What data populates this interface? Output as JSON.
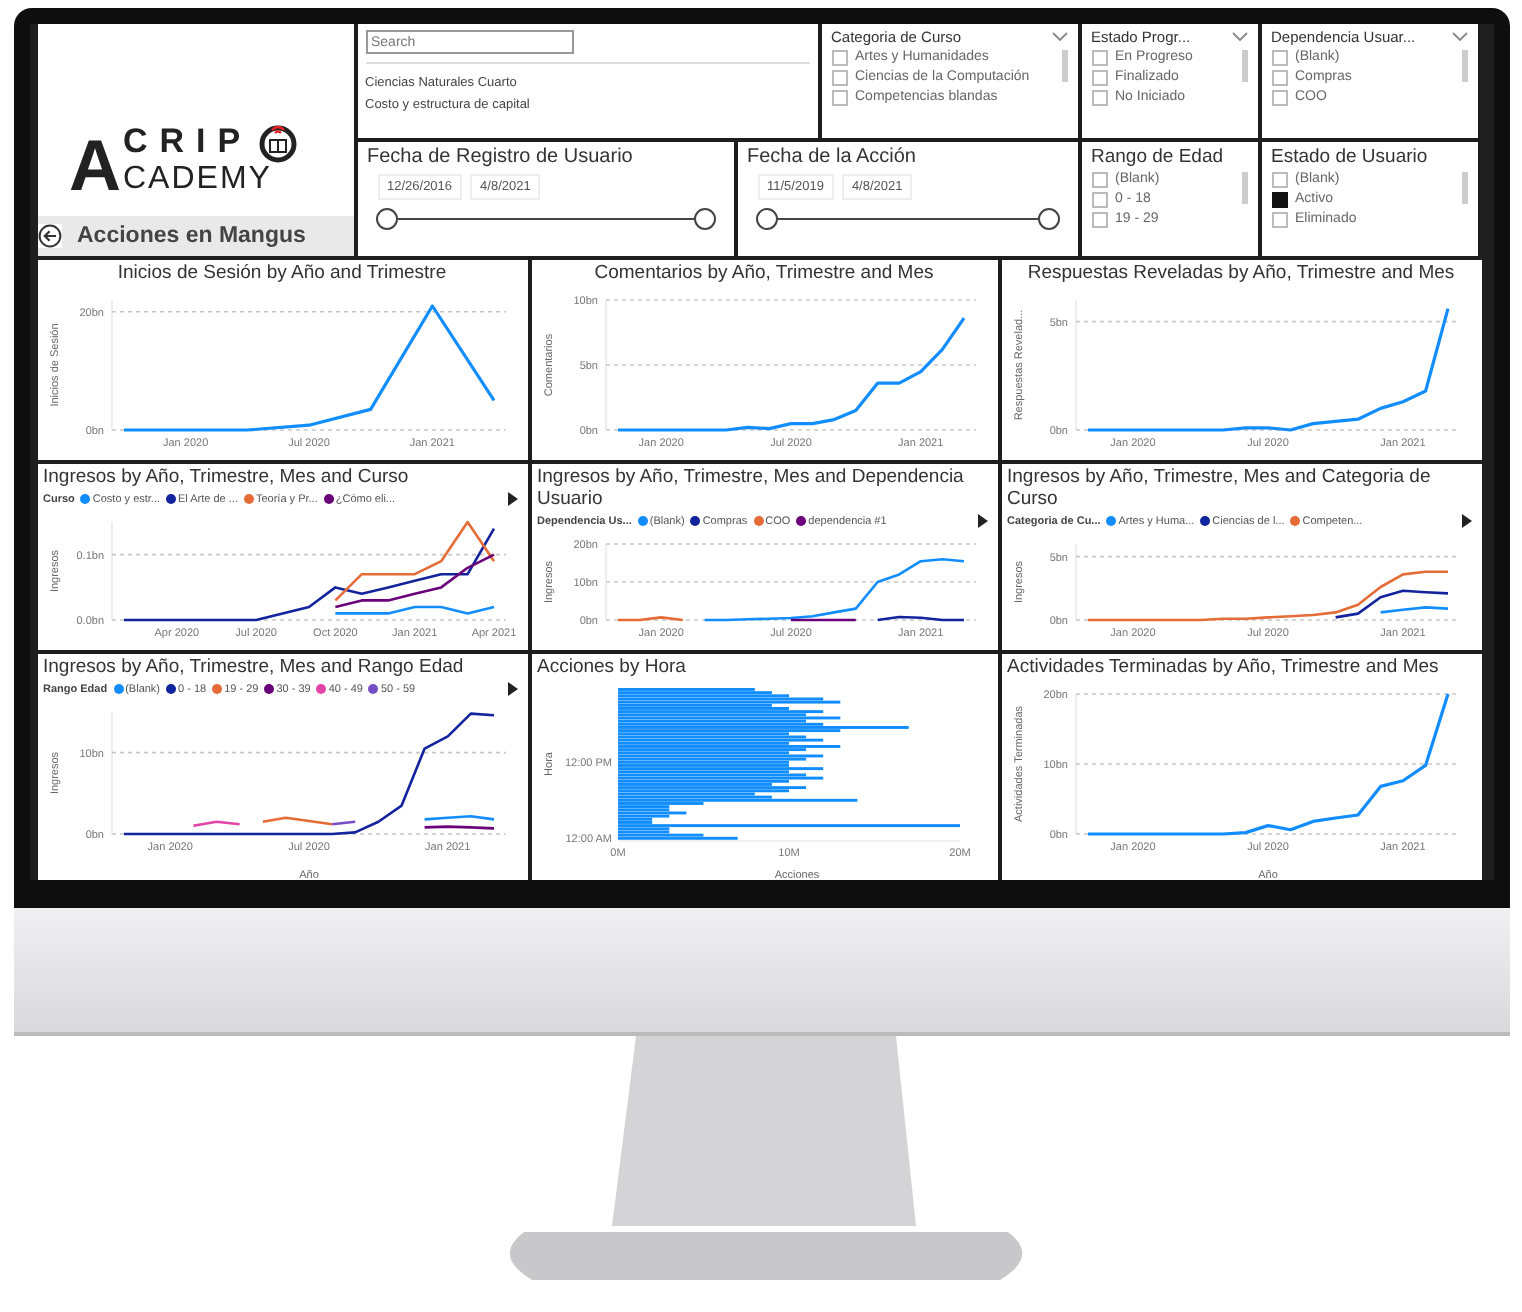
{
  "header": {
    "logo": {
      "letter": "A",
      "top": "CRIP",
      "bottom": "CADEMY"
    },
    "page_title": "Acciones en Mangus"
  },
  "slicers": [
    {
      "kind": "search-list",
      "placeholder": "Search",
      "items": [
        "Ciencias Naturales Cuarto",
        "Costo y estructura de capital"
      ]
    },
    {
      "kind": "checklist",
      "title": "Categoria de Curso",
      "dropdown": true,
      "items": [
        {
          "label": "Artes y Humanidades",
          "checked": false
        },
        {
          "label": "Ciencias de la Computación",
          "checked": false
        },
        {
          "label": "Competencias blandas",
          "checked": false
        }
      ]
    },
    {
      "kind": "checklist",
      "title": "Estado Progr...",
      "dropdown": true,
      "items": [
        {
          "label": "En Progreso",
          "checked": false
        },
        {
          "label": "Finalizado",
          "checked": false
        },
        {
          "label": "No Iniciado",
          "checked": false
        }
      ]
    },
    {
      "kind": "checklist",
      "title": "Dependencia Usuar...",
      "dropdown": true,
      "items": [
        {
          "label": "(Blank)",
          "checked": false
        },
        {
          "label": "Compras",
          "checked": false
        },
        {
          "label": "COO",
          "checked": false
        }
      ]
    },
    {
      "kind": "date-range",
      "title": "Fecha de Registro de Usuario",
      "start": "12/26/2016",
      "end": "4/8/2021"
    },
    {
      "kind": "date-range",
      "title": "Fecha de la Acción",
      "start": "11/5/2019",
      "end": "4/8/2021"
    },
    {
      "kind": "checklist",
      "title": "Rango de Edad",
      "dropdown": false,
      "items": [
        {
          "label": "(Blank)",
          "checked": false
        },
        {
          "label": "0 - 18",
          "checked": false
        },
        {
          "label": "19 - 29",
          "checked": false
        }
      ]
    },
    {
      "kind": "checklist",
      "title": "Estado de Usuario",
      "dropdown": false,
      "items": [
        {
          "label": "(Blank)",
          "checked": false
        },
        {
          "label": "Activo",
          "checked": true
        },
        {
          "label": "Eliminado",
          "checked": false
        }
      ]
    }
  ],
  "visuals": [
    {
      "chart_data": {
        "type": "line",
        "title": "Inicios de Sesión by Año and Trimestre",
        "ylabel": "Inicios de Sesión",
        "grid": true,
        "categories": [
          null,
          "Jan 2020",
          null,
          "Jul 2020",
          null,
          "Jan 2021",
          null
        ],
        "ylim": [
          0,
          22
        ],
        "yticks": [
          {
            "value": 0,
            "label": "0bn"
          },
          {
            "value": 20,
            "label": "20bn"
          }
        ],
        "series": [
          {
            "color": "#118dff",
            "values": [
              0,
              0,
              0,
              0.8,
              3.5,
              21,
              5
            ]
          }
        ]
      }
    },
    {
      "chart_data": {
        "type": "line",
        "title": "Comentarios by Año, Trimestre and Mes",
        "ylabel": "Comentarios",
        "grid": true,
        "categories": [
          null,
          null,
          "Jan 2020",
          null,
          null,
          null,
          null,
          null,
          "Jul 2020",
          null,
          null,
          null,
          null,
          null,
          "Jan 2021",
          null,
          null
        ],
        "ylim": [
          0,
          10
        ],
        "yticks": [
          {
            "value": 0,
            "label": "0bn"
          },
          {
            "value": 5,
            "label": "5bn"
          },
          {
            "value": 10,
            "label": "10bn"
          }
        ],
        "series": [
          {
            "color": "#118dff",
            "values": [
              0,
              0,
              0,
              0,
              0,
              0,
              0.2,
              0.1,
              0.5,
              0.5,
              0.8,
              1.5,
              3.6,
              3.6,
              4.5,
              6.2,
              8.6
            ]
          }
        ]
      }
    },
    {
      "chart_data": {
        "type": "line",
        "title": "Respuestas Reveladas by Año, Trimestre and Mes",
        "ylabel": "Respuestas Revelad...",
        "grid": true,
        "categories": [
          null,
          null,
          "Jan 2020",
          null,
          null,
          null,
          null,
          null,
          "Jul 2020",
          null,
          null,
          null,
          null,
          null,
          "Jan 2021",
          null,
          null
        ],
        "ylim": [
          0,
          6
        ],
        "yticks": [
          {
            "value": 0,
            "label": "0bn"
          },
          {
            "value": 5,
            "label": "5bn"
          }
        ],
        "series": [
          {
            "color": "#118dff",
            "values": [
              0,
              0,
              0,
              0,
              0,
              0,
              0,
              0.1,
              0.1,
              0,
              0.3,
              0.4,
              0.5,
              1,
              1.3,
              1.8,
              5.6
            ]
          }
        ]
      }
    },
    {
      "chart_data": {
        "type": "line",
        "title": "Ingresos by Año, Trimestre, Mes and Curso",
        "ylabel": "Ingresos",
        "grid": true,
        "legend_title": "Curso",
        "categories": [
          null,
          null,
          "Apr 2020",
          null,
          null,
          "Jul 2020",
          null,
          null,
          "Oct 2020",
          null,
          null,
          "Jan 2021",
          null,
          null,
          "Apr 2021"
        ],
        "ylim": [
          0,
          0.15
        ],
        "yticks": [
          {
            "value": 0,
            "label": "0.0bn"
          },
          {
            "value": 0.1,
            "label": "0.1bn"
          }
        ],
        "series": [
          {
            "name": "Costo y estr...",
            "color": "#118dff",
            "values": [
              null,
              null,
              null,
              null,
              null,
              null,
              null,
              null,
              0.01,
              0.01,
              0.01,
              0.02,
              0.02,
              0.01,
              0.02
            ]
          },
          {
            "name": "El Arte de ...",
            "color": "#12239e",
            "values": [
              0,
              0,
              0,
              0,
              0,
              0,
              0.01,
              0.02,
              0.05,
              0.04,
              0.05,
              0.06,
              0.07,
              0.07,
              0.14
            ]
          },
          {
            "name": "Teoría y Pr...",
            "color": "#e66c37",
            "values": [
              null,
              null,
              null,
              null,
              null,
              null,
              null,
              null,
              0.03,
              0.07,
              0.07,
              0.07,
              0.09,
              0.15,
              0.09
            ]
          },
          {
            "name": "¿Cómo eli...",
            "color": "#6b007b",
            "values": [
              null,
              null,
              null,
              null,
              null,
              null,
              null,
              null,
              0.02,
              0.03,
              0.03,
              0.04,
              0.05,
              0.08,
              0.1
            ]
          }
        ]
      }
    },
    {
      "chart_data": {
        "type": "line",
        "title": "Ingresos by Año, Trimestre, Mes and Dependencia Usuario",
        "ylabel": "Ingresos",
        "grid": true,
        "legend_title": "Dependencia Us...",
        "categories": [
          null,
          null,
          "Jan 2020",
          null,
          null,
          null,
          null,
          null,
          "Jul 2020",
          null,
          null,
          null,
          null,
          null,
          "Jan 2021",
          null,
          null
        ],
        "ylim": [
          0,
          20
        ],
        "yticks": [
          {
            "value": 0,
            "label": "0bn"
          },
          {
            "value": 10,
            "label": "10bn"
          },
          {
            "value": 20,
            "label": "20bn"
          }
        ],
        "series": [
          {
            "name": "(Blank)",
            "color": "#118dff",
            "values": [
              null,
              null,
              null,
              null,
              0,
              0,
              0.2,
              0.3,
              0.5,
              1,
              2,
              3,
              10,
              12,
              15.5,
              16,
              15.5
            ]
          },
          {
            "name": "Compras",
            "color": "#12239e",
            "values": [
              null,
              null,
              null,
              null,
              null,
              null,
              null,
              null,
              null,
              null,
              null,
              null,
              0,
              0.8,
              0.6,
              0,
              0
            ]
          },
          {
            "name": "COO",
            "color": "#e66c37",
            "values": [
              0,
              0,
              0.7,
              0,
              null,
              null,
              null,
              null,
              null,
              null,
              null,
              null,
              null,
              null,
              null,
              null,
              null
            ]
          },
          {
            "name": "dependencia #1",
            "color": "#6b007b",
            "values": [
              null,
              null,
              null,
              null,
              null,
              null,
              null,
              null,
              0,
              0,
              0,
              0,
              null,
              null,
              null,
              null,
              null
            ]
          }
        ]
      }
    },
    {
      "chart_data": {
        "type": "line",
        "title": "Ingresos by Año, Trimestre, Mes and Categoria de Curso",
        "ylabel": "Ingresos",
        "grid": true,
        "legend_title": "Categoria de Cu...",
        "categories": [
          null,
          null,
          "Jan 2020",
          null,
          null,
          null,
          null,
          null,
          "Jul 2020",
          null,
          null,
          null,
          null,
          null,
          "Jan 2021",
          null,
          null
        ],
        "ylim": [
          0,
          6
        ],
        "yticks": [
          {
            "value": 0,
            "label": "0bn"
          },
          {
            "value": 5,
            "label": "5bn"
          }
        ],
        "series": [
          {
            "name": "Artes y Huma...",
            "color": "#118dff",
            "values": [
              null,
              null,
              null,
              null,
              null,
              null,
              null,
              null,
              null,
              null,
              null,
              null,
              null,
              0.6,
              0.8,
              1,
              0.9
            ]
          },
          {
            "name": "Ciencias de l...",
            "color": "#12239e",
            "values": [
              null,
              null,
              null,
              null,
              null,
              null,
              null,
              null,
              null,
              null,
              null,
              0.2,
              0.5,
              1.8,
              2.3,
              2.2,
              2.1
            ]
          },
          {
            "name": "Competen...",
            "color": "#e66c37",
            "values": [
              0,
              0,
              0,
              0,
              0,
              0,
              0.1,
              0.1,
              0.2,
              0.3,
              0.4,
              0.6,
              1.2,
              2.6,
              3.6,
              3.8,
              3.8
            ]
          }
        ]
      }
    },
    {
      "chart_data": {
        "type": "line",
        "title": "Ingresos by Año, Trimestre, Mes and Rango Edad",
        "ylabel": "Ingresos",
        "xlabel": "Año",
        "grid": true,
        "legend_title": "Rango Edad",
        "categories": [
          null,
          null,
          "Jan 2020",
          null,
          null,
          null,
          null,
          null,
          "Jul 2020",
          null,
          null,
          null,
          null,
          null,
          "Jan 2021",
          null,
          null
        ],
        "ylim": [
          0,
          15
        ],
        "yticks": [
          {
            "value": 0,
            "label": "0bn"
          },
          {
            "value": 10,
            "label": "10bn"
          }
        ],
        "series": [
          {
            "name": "(Blank)",
            "color": "#118dff",
            "values": [
              null,
              null,
              null,
              null,
              null,
              null,
              null,
              null,
              null,
              null,
              null,
              null,
              null,
              1.8,
              2,
              2.2,
              1.8
            ]
          },
          {
            "name": "0 - 18",
            "color": "#12239e",
            "values": [
              0,
              0,
              0,
              0,
              0,
              0,
              0,
              0,
              0,
              0,
              0.2,
              1.5,
              3.5,
              10.5,
              12,
              14.8,
              14.6
            ]
          },
          {
            "name": "19 - 29",
            "color": "#e66c37",
            "values": [
              null,
              null,
              null,
              null,
              null,
              null,
              1.5,
              2,
              1.6,
              1.2,
              null,
              null,
              null,
              null,
              null,
              null,
              null
            ]
          },
          {
            "name": "30 - 39",
            "color": "#6b007b",
            "values": [
              null,
              null,
              null,
              null,
              null,
              null,
              null,
              null,
              null,
              null,
              null,
              null,
              null,
              0.8,
              0.9,
              0.8,
              0.7
            ]
          },
          {
            "name": "40 - 49",
            "color": "#e044a7",
            "values": [
              null,
              null,
              null,
              1,
              1.5,
              1.2,
              null,
              null,
              null,
              null,
              null,
              null,
              null,
              null,
              null,
              null,
              null
            ]
          },
          {
            "name": "50 - 59",
            "color": "#744ec2",
            "values": [
              null,
              null,
              null,
              null,
              null,
              null,
              null,
              null,
              null,
              1.2,
              1.5,
              null,
              null,
              null,
              null,
              null,
              null
            ]
          }
        ]
      }
    },
    {
      "chart_data": {
        "type": "bar",
        "orientation": "horizontal",
        "title": "Acciones by Hora",
        "ylabel": "Hora",
        "xlabel": "Acciones",
        "categories": [
          null,
          null,
          null,
          null,
          null,
          null,
          null,
          null,
          null,
          null,
          null,
          null,
          null,
          null,
          null,
          null,
          null,
          null,
          null,
          null,
          null,
          null,
          null,
          "12:00 PM",
          null,
          null,
          null,
          null,
          null,
          null,
          null,
          null,
          null,
          null,
          null,
          null,
          null,
          null,
          null,
          null,
          null,
          null,
          null,
          null,
          null,
          null,
          null,
          "12:00 AM"
        ],
        "xlim": [
          0,
          20
        ],
        "xticks": [
          {
            "value": 0,
            "label": "0M"
          },
          {
            "value": 10,
            "label": "10M"
          },
          {
            "value": 20,
            "label": "20M"
          }
        ],
        "series": [
          {
            "color": "#118dff",
            "values": [
              8,
              9,
              10,
              12,
              13,
              9,
              10,
              12,
              11,
              13,
              11,
              12,
              17,
              13,
              10,
              11,
              12,
              10,
              13,
              11,
              10,
              12,
              11,
              10,
              10,
              12,
              10,
              11,
              12,
              10,
              9,
              11,
              10,
              8,
              9,
              14,
              5,
              3,
              3,
              4,
              3,
              2,
              2,
              20,
              3,
              3,
              5,
              7
            ]
          }
        ]
      }
    },
    {
      "chart_data": {
        "type": "line",
        "title": "Actividades Terminadas by Año, Trimestre and Mes",
        "ylabel": "Actividades Terminadas",
        "xlabel": "Año",
        "grid": true,
        "categories": [
          null,
          null,
          "Jan 2020",
          null,
          null,
          null,
          null,
          null,
          "Jul 2020",
          null,
          null,
          null,
          null,
          null,
          "Jan 2021",
          null,
          null
        ],
        "ylim": [
          0,
          20
        ],
        "yticks": [
          {
            "value": 0,
            "label": "0bn"
          },
          {
            "value": 10,
            "label": "10bn"
          },
          {
            "value": 20,
            "label": "20bn"
          }
        ],
        "series": [
          {
            "color": "#118dff",
            "values": [
              0,
              0,
              0,
              0,
              0,
              0,
              0,
              0.2,
              1.2,
              0.6,
              1.8,
              2.3,
              2.7,
              6.8,
              7.6,
              9.8,
              20
            ]
          }
        ]
      }
    }
  ]
}
